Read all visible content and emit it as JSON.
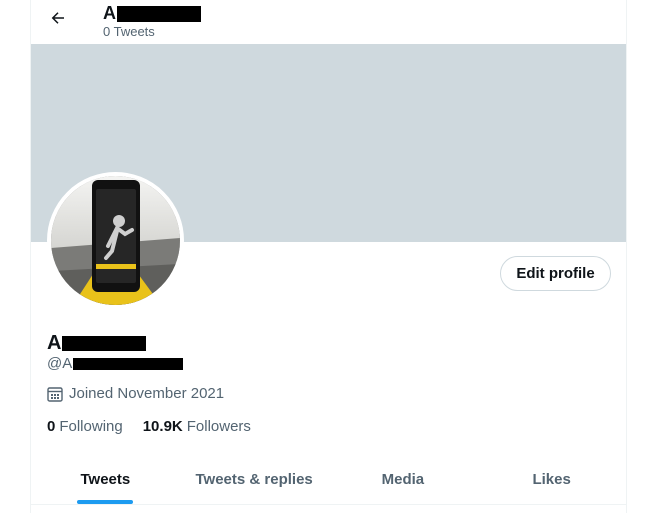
{
  "header": {
    "title_visible": "A",
    "tweet_count": "0 Tweets"
  },
  "profile": {
    "name_visible": "A",
    "handle_visible": "@A",
    "joined": "Joined November 2021",
    "following_count": "0",
    "following_label": "Following",
    "followers_count": "10.9K",
    "followers_label": "Followers",
    "edit_label": "Edit profile"
  },
  "tabs": [
    {
      "label": "Tweets",
      "active": true
    },
    {
      "label": "Tweets & replies",
      "active": false
    },
    {
      "label": "Media",
      "active": false
    },
    {
      "label": "Likes",
      "active": false
    }
  ],
  "icons": {
    "back": "arrow-left-icon",
    "calendar": "calendar-icon"
  },
  "colors": {
    "accent": "#1d9bf0",
    "banner": "#cfd9de",
    "secondary_text": "#536471"
  }
}
